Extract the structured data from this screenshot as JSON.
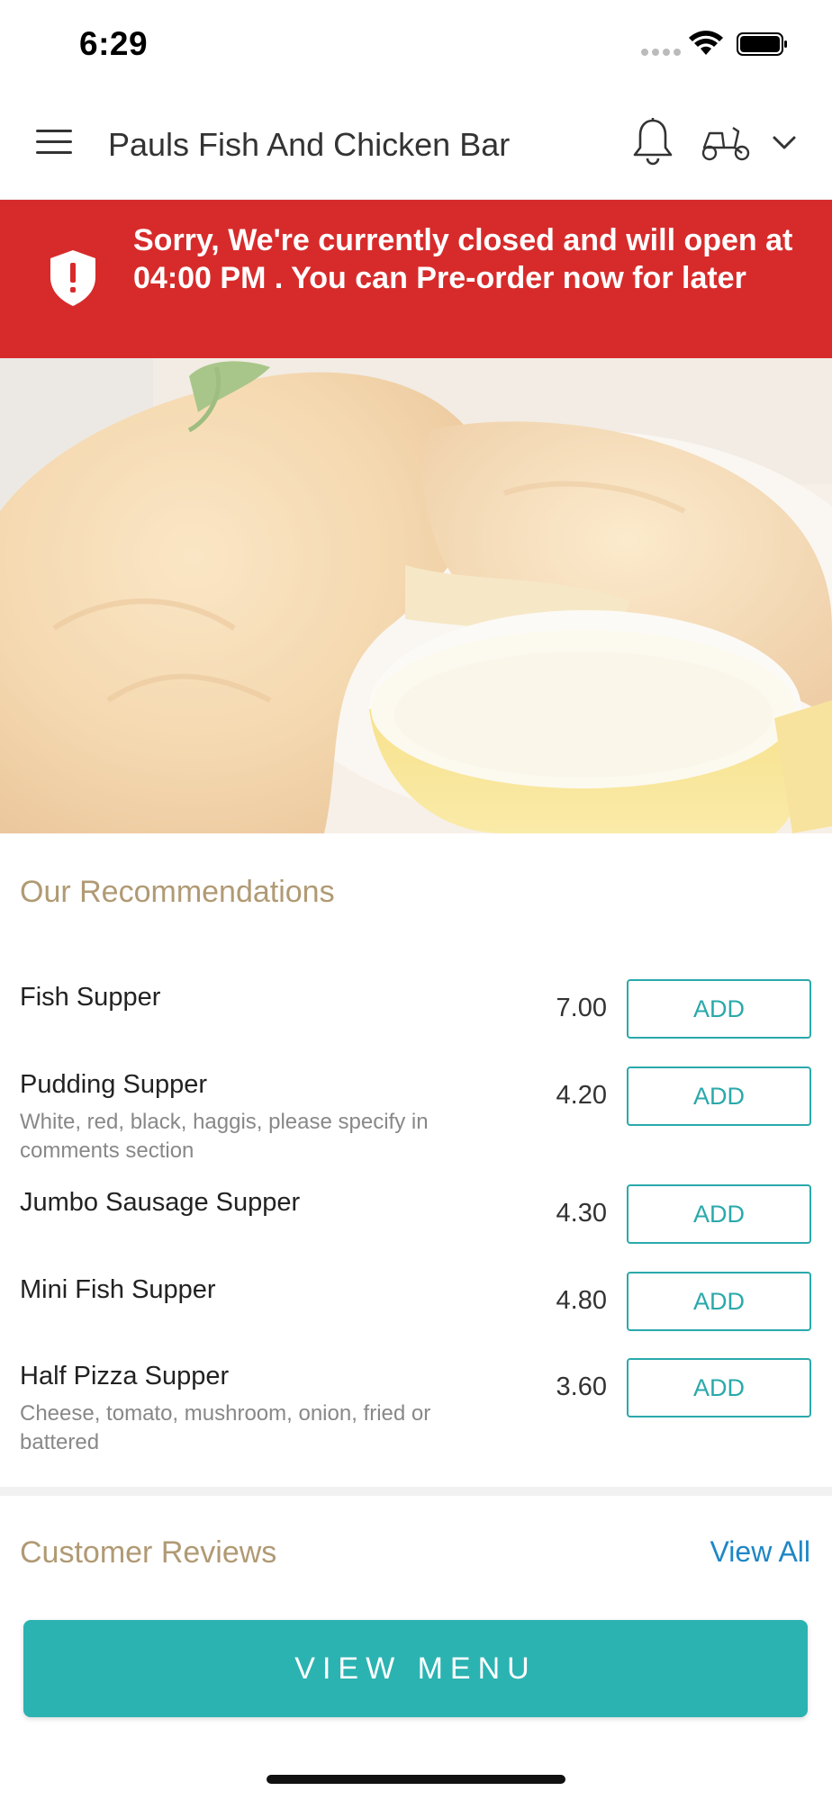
{
  "status_bar": {
    "time": "6:29"
  },
  "header": {
    "title": "Pauls Fish And Chicken Bar"
  },
  "banner": {
    "message": "Sorry, We're currently closed and will open at 04:00 PM . You can Pre-order now for later"
  },
  "recommendations": {
    "title": "Our Recommendations",
    "items": [
      {
        "name": "Fish Supper",
        "description": "",
        "price": "7.00",
        "button": "ADD"
      },
      {
        "name": "Pudding Supper",
        "description": "White, red, black, haggis, please specify in comments section",
        "price": "4.20",
        "button": "ADD"
      },
      {
        "name": "Jumbo Sausage Supper",
        "description": "",
        "price": "4.30",
        "button": "ADD"
      },
      {
        "name": "Mini Fish Supper",
        "description": "",
        "price": "4.80",
        "button": "ADD"
      },
      {
        "name": "Half Pizza Supper",
        "description": "Cheese, tomato, mushroom, onion, fried or battered",
        "price": "3.60",
        "button": "ADD"
      }
    ]
  },
  "reviews": {
    "title": "Customer Reviews",
    "view_all": "View All"
  },
  "footer": {
    "view_menu": "VIEW MENU"
  },
  "colors": {
    "banner": "#d72b2b",
    "accent": "#2bb3b2",
    "section_title": "#b09a74",
    "link": "#1e86c6"
  }
}
